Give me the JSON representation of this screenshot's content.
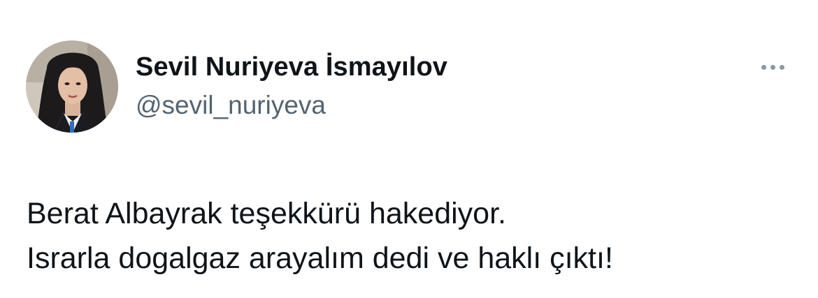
{
  "author": {
    "display_name": "Sevil Nuriyeva İsmayılov",
    "handle": "@sevil_nuriyeva",
    "avatar_icon": "profile-photo"
  },
  "actions": {
    "more_icon": "more-horizontal-icon"
  },
  "tweet": {
    "lines": [
      "Berat Albayrak teşekkürü hakediyor.",
      "Israrla dogalgaz arayalım dedi ve haklı çıktı!"
    ]
  },
  "colors": {
    "text_primary": "#0f1419",
    "text_secondary": "#536471",
    "icon_muted": "#8b98a5",
    "background": "#ffffff"
  }
}
